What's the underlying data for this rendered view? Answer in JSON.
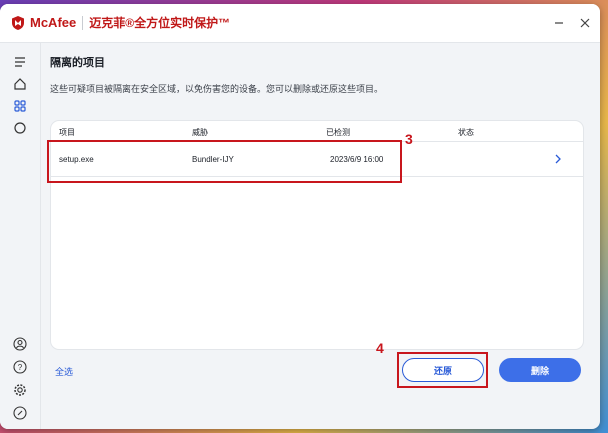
{
  "brand": {
    "name": "McAfee",
    "product": "迈克菲®全方位实时保护™"
  },
  "page": {
    "title": "隔离的项目",
    "description": "这些可疑项目被隔离在安全区域，以免伤害您的设备。您可以删除或还原这些项目。"
  },
  "table": {
    "headers": [
      "项目",
      "威胁",
      "已检测",
      "状态"
    ],
    "rows": [
      {
        "item": "setup.exe",
        "threat": "Bundler-IJY",
        "detected": "2023/6/9 16:00",
        "status": ""
      }
    ]
  },
  "actions": {
    "select_all": "全选",
    "restore": "还原",
    "delete": "删除"
  },
  "annotations": {
    "row_marker": "3",
    "restore_marker": "4"
  },
  "colors": {
    "brand_red": "#c01818",
    "accent_blue": "#3d6fe8",
    "annotation_red": "#c8161d"
  },
  "icons": {
    "sidebar": [
      "menu-icon",
      "home-icon",
      "apps-grid-icon",
      "circle-scan-icon",
      "account-icon",
      "help-icon",
      "settings-icon",
      "feedback-icon"
    ],
    "window": [
      "minimize-icon",
      "close-icon"
    ]
  }
}
